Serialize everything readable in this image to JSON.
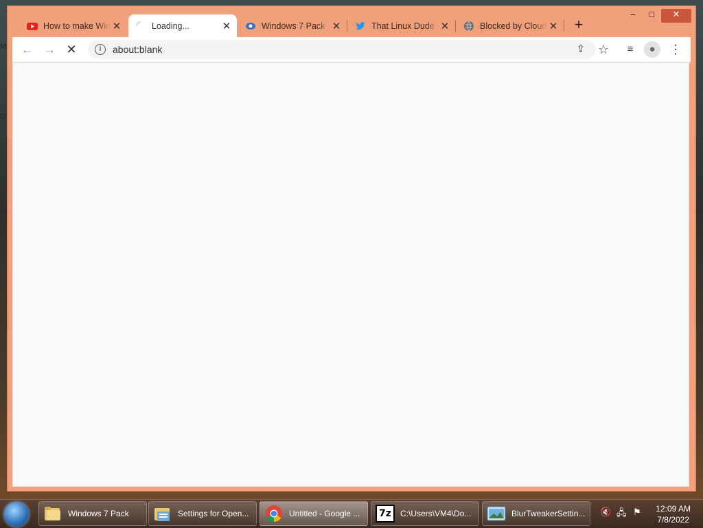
{
  "desktop": {
    "edge_labels": [
      "M",
      "D"
    ]
  },
  "browser": {
    "tabs": [
      {
        "title": "How to make Win",
        "favicon": "youtube-icon",
        "active": false
      },
      {
        "title": "Loading...",
        "favicon": "loading-spinner-icon",
        "active": true
      },
      {
        "title": "Windows 7 Pack",
        "favicon": "site-icon",
        "active": false
      },
      {
        "title": "That Linux Dude",
        "favicon": "twitter-icon",
        "active": false
      },
      {
        "title": "Blocked by Cloud",
        "favicon": "globe-icon",
        "active": false
      }
    ],
    "new_tab_label": "+",
    "window_controls": {
      "minimize": "–",
      "maximize": "□",
      "close": "✕"
    },
    "toolbar": {
      "back": "←",
      "forward": "→",
      "stop": "✕",
      "url": "about:blank",
      "share": "⇪",
      "bookmark": "☆",
      "media": "≡",
      "profile": "●",
      "menu": "⋮"
    }
  },
  "taskbar": {
    "items": [
      {
        "label": "Windows 7 Pack",
        "icon": "folder-icon",
        "active": false
      },
      {
        "label": "Settings for Open...",
        "icon": "settings-folder-icon",
        "active": false
      },
      {
        "label": "Untitled - Google ...",
        "icon": "chrome-icon",
        "active": true
      },
      {
        "label": "C:\\Users\\VM4\\Do...",
        "icon": "7zip-icon",
        "active": false
      },
      {
        "label": "BlurTweakerSettin...",
        "icon": "blurtweaker-icon",
        "active": false
      }
    ],
    "clock": {
      "time": "12:09 AM",
      "date": "7/8/2022"
    },
    "seven_zip_text": "7z"
  },
  "colors": {
    "frame": "#f0a07a",
    "accent": "#c9563c"
  }
}
